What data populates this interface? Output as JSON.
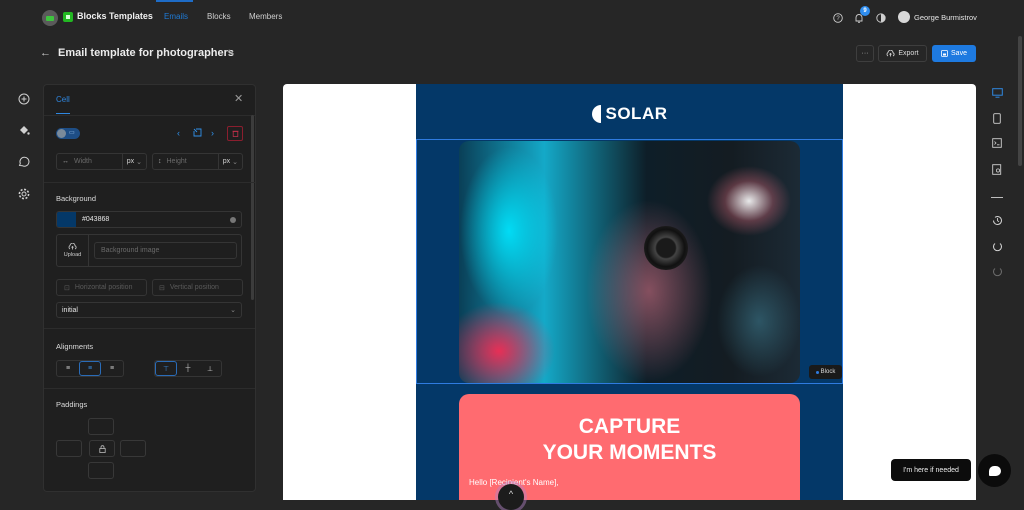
{
  "topbar": {
    "brand": "Blocks Templates",
    "tabs": [
      {
        "label": "Emails",
        "active": true
      },
      {
        "label": "Blocks",
        "active": false
      },
      {
        "label": "Members",
        "active": false
      }
    ],
    "notification_count": "9",
    "user_name": "George Burmistrov",
    "icons": [
      "help-icon",
      "bell-icon",
      "theme-toggle-icon",
      "avatar"
    ]
  },
  "title_row": {
    "title": "Email template for photographers",
    "more_label": "···",
    "export_label": "Export",
    "save_label": "Save"
  },
  "left_rail": [
    "add-icon",
    "paint-bucket-icon",
    "comments-icon",
    "settings-icon"
  ],
  "panel": {
    "tab": "Cell",
    "width_placeholder": "Width",
    "height_placeholder": "Height",
    "width_unit": "px",
    "height_unit": "px",
    "background_label": "Background",
    "background_color": "#043868",
    "upload_label": "Upload",
    "background_image_placeholder": "Background image",
    "horizontal_position_placeholder": "Horizontal position",
    "vertical_position_placeholder": "Vertical position",
    "repeat_value": "initial",
    "alignments_label": "Alignments",
    "horizontal_alignment_selected": "center",
    "vertical_alignment_selected": "top",
    "paddings_label": "Paddings"
  },
  "email": {
    "logo_text": "SOLAR",
    "block_tag": "Block",
    "headline_line1": "CAPTURE",
    "headline_line2": "YOUR MOMENTS",
    "greeting": "Hello [Recipient's Name],",
    "colors": {
      "background": "#043868",
      "promo": "#ff6b70"
    }
  },
  "right_rail": [
    "desktop-icon",
    "mobile-icon",
    "code-icon",
    "preview-icon",
    "divider",
    "history-icon",
    "undo-icon",
    "redo-icon"
  ],
  "helper": {
    "message": "I'm here if needed"
  }
}
